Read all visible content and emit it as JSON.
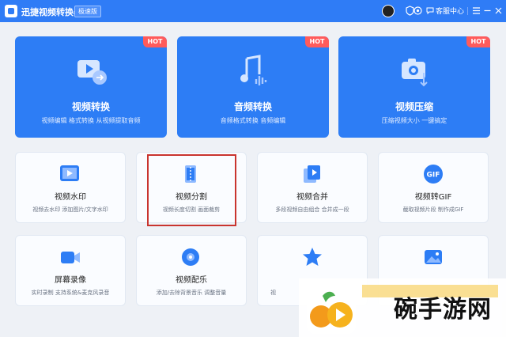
{
  "titlebar": {
    "title": "迅捷视频转换器",
    "edition_badge": "极速版",
    "service_label": "客服中心",
    "icons": [
      "avatar",
      "shield-icon",
      "gear-icon",
      "chat-icon",
      "menu-icon",
      "minimize-icon",
      "close-icon"
    ]
  },
  "hot_label": "HOT",
  "big_cards": [
    {
      "name": "视频转换",
      "desc": "视频编辑 格式转换 从视频提取音频",
      "icon": "video-convert-icon"
    },
    {
      "name": "音频转换",
      "desc": "音频格式转换 音频编辑",
      "icon": "audio-convert-icon"
    },
    {
      "name": "视频压缩",
      "desc": "压缩视频大小 一键搞定",
      "icon": "video-compress-icon"
    }
  ],
  "small_cards": [
    {
      "name": "视频水印",
      "desc": "视频去水印 添加图片/文字水印",
      "icon": "watermark-icon"
    },
    {
      "name": "视频分割",
      "desc": "视频长度切割 画面裁剪",
      "icon": "split-icon"
    },
    {
      "name": "视频合并",
      "desc": "多段视频自由组合 合并成一段",
      "icon": "merge-icon"
    },
    {
      "name": "视频转GIF",
      "desc": "截取视频片段 制作成GIF",
      "icon": "gif-icon",
      "gif_text": "GIF"
    },
    {
      "name": "屏幕录像",
      "desc": "实时录制 支持系统&麦克风录音",
      "icon": "screen-record-icon"
    },
    {
      "name": "视频配乐",
      "desc": "添加/去除背景音乐 调整音量",
      "icon": "music-icon"
    },
    {
      "name": "",
      "desc": "视",
      "icon": "star-icon"
    },
    {
      "name": "",
      "desc": "",
      "icon": "image-icon"
    }
  ],
  "watermark": {
    "text": "碗手游网"
  },
  "colors": {
    "brand": "#2f7cf6",
    "hot": "#ff5b5b",
    "highlight": "#c9342e"
  }
}
